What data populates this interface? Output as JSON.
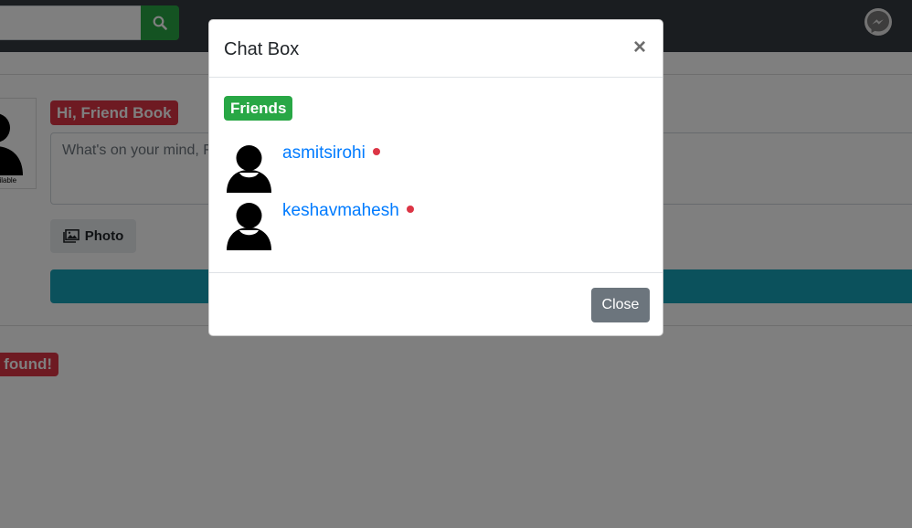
{
  "navbar": {
    "search": {
      "placeholder": "",
      "button_icon": "search-icon"
    },
    "messenger_icon": "messenger-icon"
  },
  "profile": {
    "avatar_caption": "vailable",
    "greeting": "Hi, Friend Book"
  },
  "composer": {
    "placeholder": "What's on your mind, F",
    "photo_label": "Photo"
  },
  "feed": {
    "empty_text": "s found!"
  },
  "chat_modal": {
    "title": "Chat Box",
    "close_symbol": "×",
    "section_badge": "Friends",
    "friends": [
      {
        "username": "asmitsirohi",
        "status_color": "#dc3545"
      },
      {
        "username": "keshavmahesh",
        "status_color": "#dc3545"
      }
    ],
    "close_button": "Close"
  },
  "colors": {
    "success": "#28a745",
    "danger": "#dc3545",
    "info": "#17a2b8",
    "link": "#007bff",
    "secondary": "#6c757d"
  }
}
